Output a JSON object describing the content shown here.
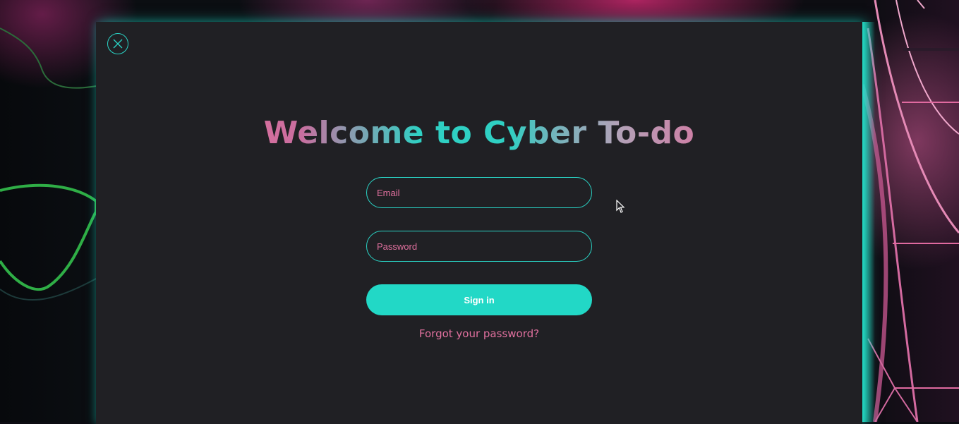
{
  "modal": {
    "title": "Welcome to Cyber To-do",
    "close_icon": "close-circle-icon"
  },
  "form": {
    "email_placeholder": "Email",
    "password_placeholder": "Password",
    "signin_label": "Sign in",
    "forgot_label": "Forgot your password?"
  },
  "colors": {
    "accent_teal": "#22d8c6",
    "accent_pink": "#e0709e",
    "panel_bg": "#202024"
  }
}
